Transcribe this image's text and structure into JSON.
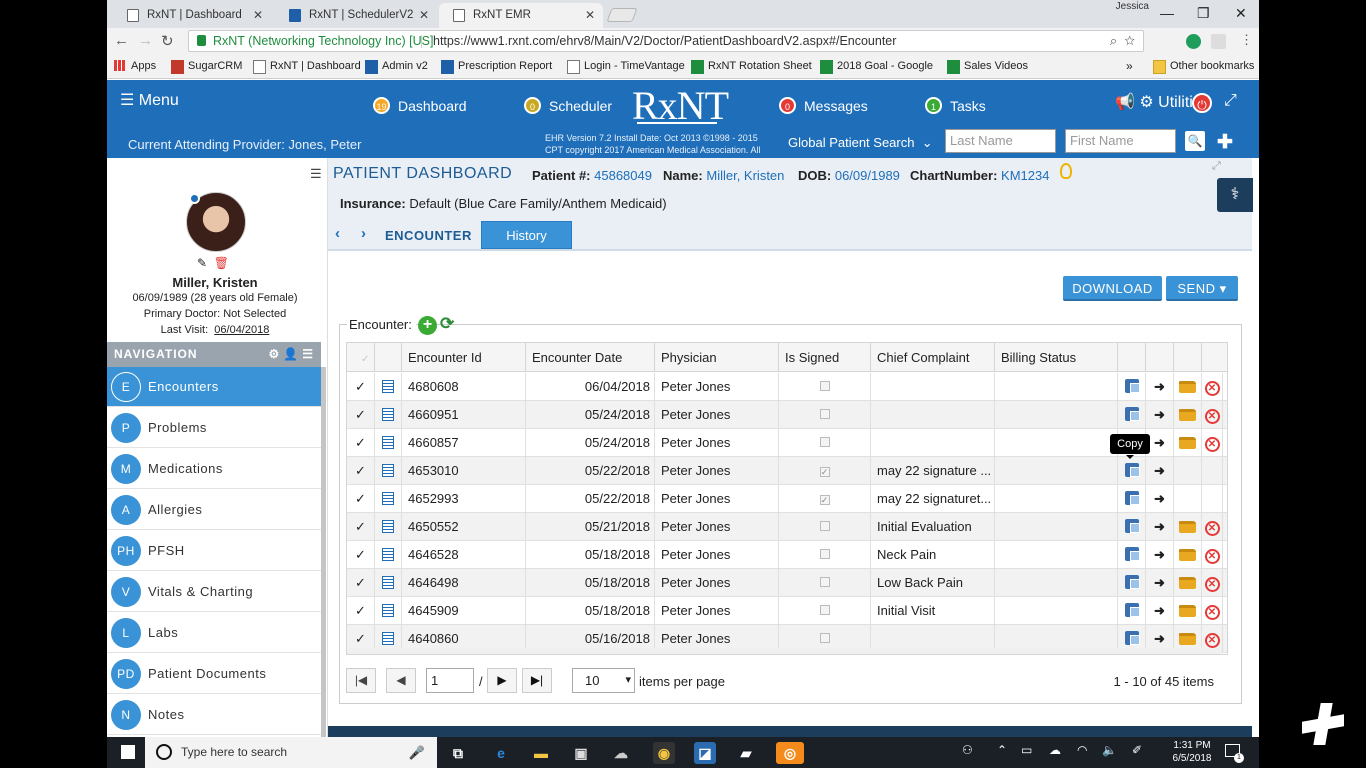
{
  "browser": {
    "user": "Jessica",
    "tabs": [
      {
        "title": "RxNT | Dashboard"
      },
      {
        "title": "RxNT | SchedulerV2"
      },
      {
        "title": "RxNT EMR"
      }
    ],
    "secure_label": "RxNT (Networking Technology Inc) [US]",
    "url": "https://www1.rxnt.com/ehrv8/Main/V2/Doctor/PatientDashboardV2.aspx#/Encounter",
    "bookmarks": [
      "Apps",
      "SugarCRM",
      "RxNT | Dashboard",
      "Admin v2",
      "Prescription Report",
      "Login - TimeVantage",
      "RxNT Rotation Sheet",
      "2018 Goal - Google",
      "Sales Videos",
      "Other bookmarks"
    ],
    "bookmarks_overflow": "»"
  },
  "header": {
    "menu_label": "Menu",
    "logo": "RxNT",
    "nav": [
      {
        "label": "Dashboard",
        "badge": "19",
        "color": "#f5a623"
      },
      {
        "label": "Scheduler",
        "badge": "0",
        "color": "#c8a820"
      },
      {
        "label": "Messages",
        "badge": "0",
        "color": "#e53935"
      },
      {
        "label": "Tasks",
        "badge": "1",
        "color": "#3aaa35"
      }
    ],
    "utilities_label": "Utilities",
    "provider": "Current Attending Provider: Jones, Peter",
    "ehr_version": "EHR Version 7.2 Install Date: Oct 2013 ©1998 - 2015",
    "cpt": "CPT copyright 2017 American Medical Association. All",
    "global_search": "Global Patient Search",
    "last_name_placeholder": "Last Name",
    "first_name_placeholder": "First Name"
  },
  "patient": {
    "name": "Miller, Kristen",
    "dob_age": "06/09/1989 (28 years old Female)",
    "primary_doctor": "Primary Doctor: Not Selected",
    "last_visit_label": "Last Visit:",
    "last_visit": "06/04/2018"
  },
  "navigation": {
    "header": "NAVIGATION",
    "items": [
      {
        "abbr": "E",
        "label": "Encounters"
      },
      {
        "abbr": "P",
        "label": "Problems"
      },
      {
        "abbr": "M",
        "label": "Medications"
      },
      {
        "abbr": "A",
        "label": "Allergies"
      },
      {
        "abbr": "PH",
        "label": "PFSH"
      },
      {
        "abbr": "V",
        "label": "Vitals & Charting"
      },
      {
        "abbr": "L",
        "label": "Labs"
      },
      {
        "abbr": "PD",
        "label": "Patient Documents"
      },
      {
        "abbr": "N",
        "label": "Notes"
      }
    ]
  },
  "dashboard": {
    "title": "PATIENT DASHBOARD",
    "patient_no_label": "Patient #:",
    "patient_no": "45868049",
    "name_label": "Name:",
    "name": "Miller, Kristen",
    "dob_label": "DOB:",
    "dob": "06/09/1989",
    "chart_label": "ChartNumber:",
    "chart": "KM1234",
    "insurance_label": "Insurance:",
    "insurance": "Default (Blue Care Family/Anthem Medicaid)",
    "tab_encounter": "ENCOUNTER",
    "tab_history": "History",
    "download": "DOWNLOAD",
    "send": "SEND ▾"
  },
  "encounters": {
    "label": "Encounter:",
    "columns": [
      "Encounter Id",
      "Encounter Date",
      "Physician",
      "Is Signed",
      "Chief Complaint",
      "Billing Status"
    ],
    "rows": [
      {
        "id": "4680608",
        "date": "06/04/2018",
        "physician": "Peter Jones",
        "signed": false,
        "cc": "",
        "folder": true
      },
      {
        "id": "4660951",
        "date": "05/24/2018",
        "physician": "Peter Jones",
        "signed": false,
        "cc": "",
        "folder": true
      },
      {
        "id": "4660857",
        "date": "05/24/2018",
        "physician": "Peter Jones",
        "signed": false,
        "cc": "",
        "folder": true
      },
      {
        "id": "4653010",
        "date": "05/22/2018",
        "physician": "Peter Jones",
        "signed": true,
        "cc": "may 22 signature ...",
        "folder": false
      },
      {
        "id": "4652993",
        "date": "05/22/2018",
        "physician": "Peter Jones",
        "signed": true,
        "cc": "may 22 signaturet...",
        "folder": false
      },
      {
        "id": "4650552",
        "date": "05/21/2018",
        "physician": "Peter Jones",
        "signed": false,
        "cc": "Initial Evaluation",
        "folder": true
      },
      {
        "id": "4646528",
        "date": "05/18/2018",
        "physician": "Peter Jones",
        "signed": false,
        "cc": "Neck Pain",
        "folder": true
      },
      {
        "id": "4646498",
        "date": "05/18/2018",
        "physician": "Peter Jones",
        "signed": false,
        "cc": "Low Back Pain",
        "folder": true
      },
      {
        "id": "4645909",
        "date": "05/18/2018",
        "physician": "Peter Jones",
        "signed": false,
        "cc": "Initial Visit",
        "folder": true
      },
      {
        "id": "4640860",
        "date": "05/16/2018",
        "physician": "Peter Jones",
        "signed": false,
        "cc": "",
        "folder": true
      }
    ],
    "tooltip": "Copy",
    "pager": {
      "page": "1",
      "of": "/ 5",
      "per_page": "10",
      "per_page_label": "items per page",
      "info": "1 - 10 of 45 items"
    }
  },
  "taskbar": {
    "search_placeholder": "Type here to search",
    "time": "1:31 PM",
    "date": "6/5/2018",
    "notifications": "1"
  }
}
